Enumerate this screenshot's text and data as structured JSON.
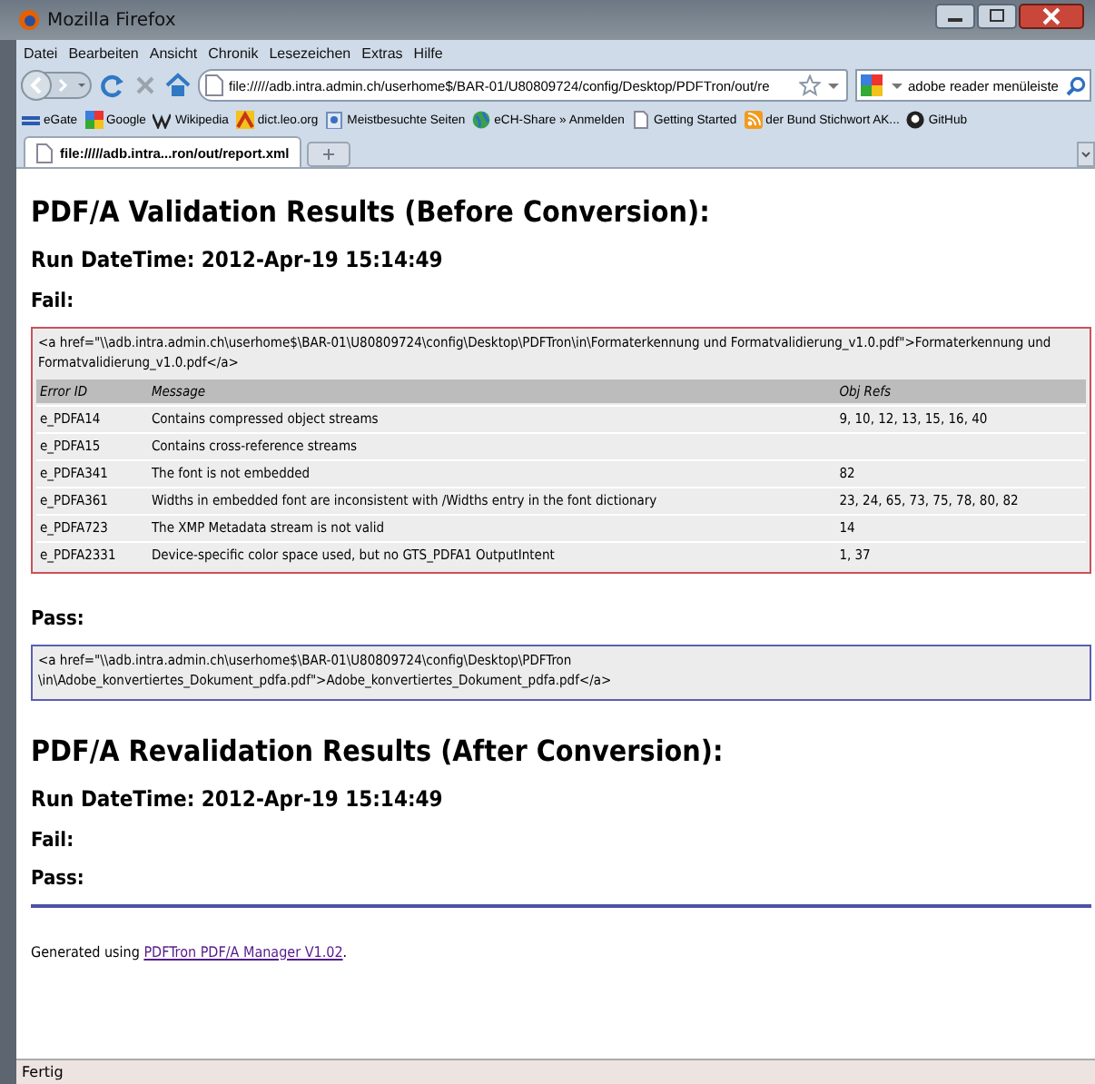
{
  "window": {
    "title": "Mozilla Firefox"
  },
  "menu": [
    "Datei",
    "Bearbeiten",
    "Ansicht",
    "Chronik",
    "Lesezeichen",
    "Extras",
    "Hilfe"
  ],
  "toolbar": {
    "url": "file://///adb.intra.admin.ch/userhome$/BAR-01/U80809724/config/Desktop/PDFTron/out/re",
    "search": "adobe reader menüleiste"
  },
  "bookmarks": [
    {
      "label": "eGate",
      "kind": "gate"
    },
    {
      "label": "Google",
      "kind": "google"
    },
    {
      "label": "Wikipedia",
      "kind": "wiki"
    },
    {
      "label": "dict.leo.org",
      "kind": "leo"
    },
    {
      "label": "Meistbesuchte Seiten",
      "kind": "folder"
    },
    {
      "label": "eCH-Share » Anmelden",
      "kind": "globe"
    },
    {
      "label": "Getting Started",
      "kind": "page"
    },
    {
      "label": "der Bund Stichwort AK...",
      "kind": "feed"
    },
    {
      "label": "GitHub",
      "kind": "github"
    }
  ],
  "tabs": [
    {
      "label": "file://///adb.intra...ron/out/report.xml",
      "selected": true
    }
  ],
  "report": {
    "sections": [
      {
        "heading": "PDF/A Validation Results (Before Conversion):",
        "run": "Run DateTime: 2012-Apr-19 15:14:49",
        "results": [
          {
            "label": "Fail:",
            "kind": "fail",
            "file": "<a href=\"\\\\adb.intra.admin.ch\\userhome$\\BAR-01\\U80809724\\config\\Desktop\\PDFTron\\in\\Formaterkennung und Formatvalidierung_v1.0.pdf\">Formaterkennung und Formatvalidierung_v1.0.pdf</a>",
            "columns": [
              "Error ID",
              "Message",
              "Obj Refs"
            ],
            "rows": [
              [
                "e_PDFA14",
                "Contains compressed object streams",
                "9, 10, 12, 13, 15, 16, 40"
              ],
              [
                "e_PDFA15",
                "Contains cross-reference streams",
                ""
              ],
              [
                "e_PDFA341",
                "The font is not embedded",
                "82"
              ],
              [
                "e_PDFA361",
                "Widths in embedded font are inconsistent with /Widths entry in the font dictionary",
                "23, 24, 65, 73, 75, 78, 80, 82"
              ],
              [
                "e_PDFA723",
                "The XMP Metadata stream is not valid",
                "14"
              ],
              [
                "e_PDFA2331",
                "Device-specific color space used, but no GTS_PDFA1 OutputIntent",
                "1, 37"
              ]
            ]
          },
          {
            "label": "Pass:",
            "kind": "pass",
            "file": "<a href=\"\\\\adb.intra.admin.ch\\userhome$\\BAR-01\\U80809724\\config\\Desktop\\PDFTron \\in\\Adobe_konvertiertes_Dokument_pdfa.pdf\">Adobe_konvertiertes_Dokument_pdfa.pdf</a>"
          }
        ]
      },
      {
        "heading": "PDF/A Revalidation Results (After Conversion):",
        "run": "Run DateTime: 2012-Apr-19 15:14:49",
        "results": [
          {
            "label": "Fail:",
            "kind": "fail"
          },
          {
            "label": "Pass:",
            "kind": "pass"
          }
        ]
      }
    ]
  },
  "footer": {
    "prefix": "Generated using",
    "link": "PDFTron PDF/A Manager V1.02",
    "suffix": "."
  },
  "status_bar": "Fertig"
}
